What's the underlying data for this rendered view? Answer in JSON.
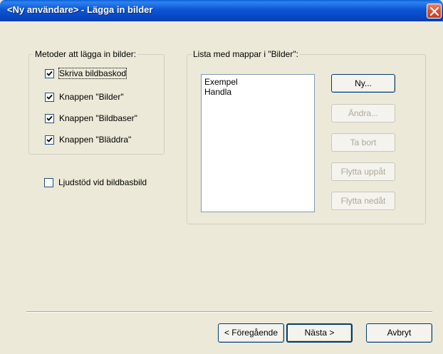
{
  "window": {
    "title": "<Ny användare> - Lägga in bilder",
    "close_icon": "close-icon"
  },
  "methods_group": {
    "legend": "Metoder att lägga in bilder:",
    "items": [
      {
        "label": "Skriva bildbaskod",
        "checked": true
      },
      {
        "label": "Knappen \"Bilder\"",
        "checked": true
      },
      {
        "label": "Knappen \"Bildbaser\"",
        "checked": true
      },
      {
        "label": "Knappen \"Bläddra\"",
        "checked": true
      }
    ]
  },
  "sound_support": {
    "label": "Ljudstöd vid bildbasbild",
    "checked": false
  },
  "folders_group": {
    "legend": "Lista med mappar i \"Bilder\":",
    "list_items": [
      "Exempel",
      "Handla"
    ],
    "buttons": {
      "new": "Ny...",
      "change": "Ändra...",
      "remove": "Ta bort",
      "move_up": "Flytta uppåt",
      "move_down": "Flytta nedåt"
    }
  },
  "footer": {
    "previous": "< Föregående",
    "next": "Nästa >",
    "cancel": "Avbryt"
  },
  "colors": {
    "titlebar": "#0b56d4",
    "dialog_bg": "#ece9d8",
    "disabled_text": "#aca899"
  }
}
